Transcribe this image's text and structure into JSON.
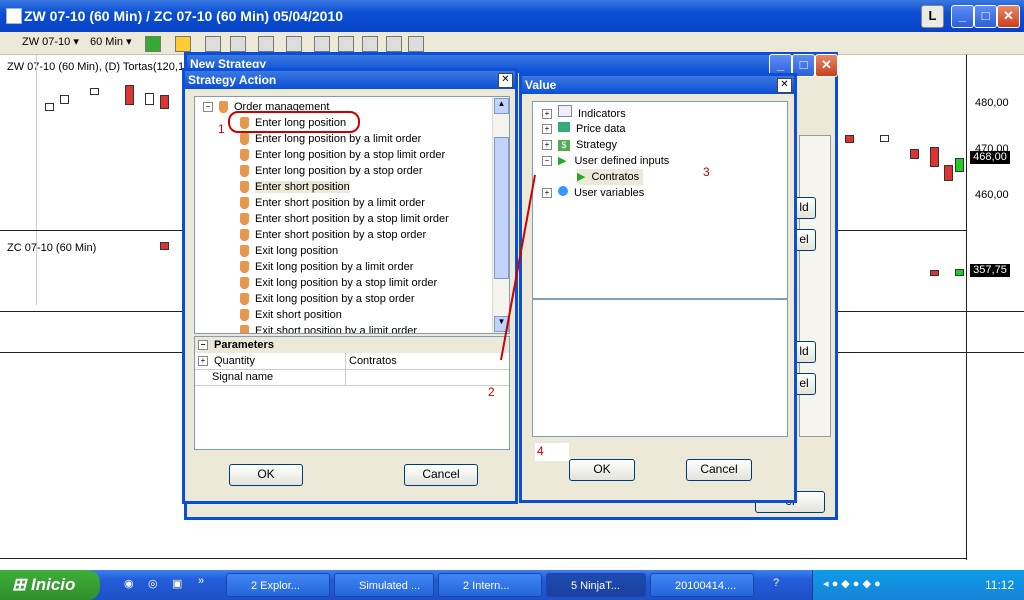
{
  "window": {
    "title": "ZW 07-10 (60 Min) / ZC 07-10 (60 Min)  05/04/2010",
    "btn_l": "L",
    "min": "_",
    "max": "□",
    "close": "✕"
  },
  "toolbar": {
    "instrument": "ZW 07-10",
    "interval": "60 Min"
  },
  "chart": {
    "top_label": "ZW 07-10 (60 Min), (D) Tortas(120,1",
    "bottom_label": "ZC 07-10 (60 Min)",
    "axis": [
      "480,00",
      "470,00",
      "460,00"
    ],
    "last_price": "468,00",
    "last_price2": "357,75"
  },
  "bg_window": {
    "title": "New Strategy",
    "btn1": "ld",
    "btn2": "el",
    "btn3": "ld",
    "btn4": "el",
    "btn5": "el"
  },
  "strategy_action": {
    "title": "Strategy Action",
    "root": "Order management",
    "items": [
      "Enter long position",
      "Enter long position by a limit order",
      "Enter long position by a stop limit order",
      "Enter long position by a stop order",
      "Enter short position",
      "Enter short position by a limit order",
      "Enter short position by a stop limit order",
      "Enter short position by a stop order",
      "Exit long position",
      "Exit long position by a limit order",
      "Exit long position by a stop limit order",
      "Exit long position by a stop order",
      "Exit short position",
      "Exit short position by a limit order"
    ],
    "params_header": "Parameters",
    "params": [
      {
        "name": "Quantity",
        "value": "Contratos"
      },
      {
        "name": "Signal name",
        "value": ""
      }
    ],
    "ok": "OK",
    "cancel": "Cancel"
  },
  "value_dialog": {
    "title": "Value",
    "tree": [
      "Indicators",
      "Price data",
      "Strategy",
      "User defined inputs",
      "Contratos",
      "User variables"
    ],
    "ok": "OK",
    "cancel": "Cancel"
  },
  "annotations": {
    "n1": "1",
    "n2": "2",
    "n3": "3",
    "n4": "4",
    "color": "#cc0000"
  },
  "taskbar": {
    "start": "Inicio",
    "tasks": [
      "2 Explor...",
      "Simulated ...",
      "2 Intern...",
      "5 NinjaT...",
      "20100414...."
    ],
    "clock": "11:12"
  }
}
